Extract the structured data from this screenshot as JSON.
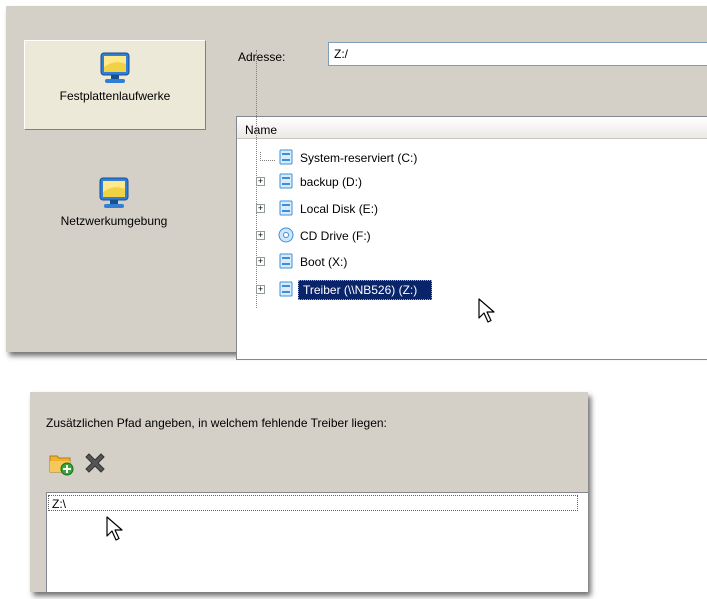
{
  "sidebar": {
    "items": [
      {
        "label": "Festplattenlaufwerke",
        "icon": "computer-icon"
      },
      {
        "label": "Netzwerkumgebung",
        "icon": "computer-icon"
      }
    ]
  },
  "address": {
    "label": "Adresse:",
    "value": "Z:/"
  },
  "tree": {
    "header": "Name",
    "items": [
      {
        "label": "System-reserviert (C:)",
        "icon": "drive-icon"
      },
      {
        "label": "backup (D:)",
        "icon": "drive-icon"
      },
      {
        "label": "Local Disk (E:)",
        "icon": "drive-icon"
      },
      {
        "label": "CD Drive (F:)",
        "icon": "cd-drive-icon"
      },
      {
        "label": "Boot (X:)",
        "icon": "drive-icon"
      },
      {
        "label": "Treiber (\\\\NB526) (Z:)",
        "icon": "drive-icon"
      }
    ],
    "selected_index": 5
  },
  "driver_path": {
    "hint": "Zusätzlichen Pfad angeben, in welchem fehlende Treiber liegen:",
    "paths": [
      "Z:\\"
    ]
  },
  "colors": {
    "panel": "#d4d0c8",
    "selection": "#0a246a",
    "icon_blue": "#3f8fd8"
  }
}
